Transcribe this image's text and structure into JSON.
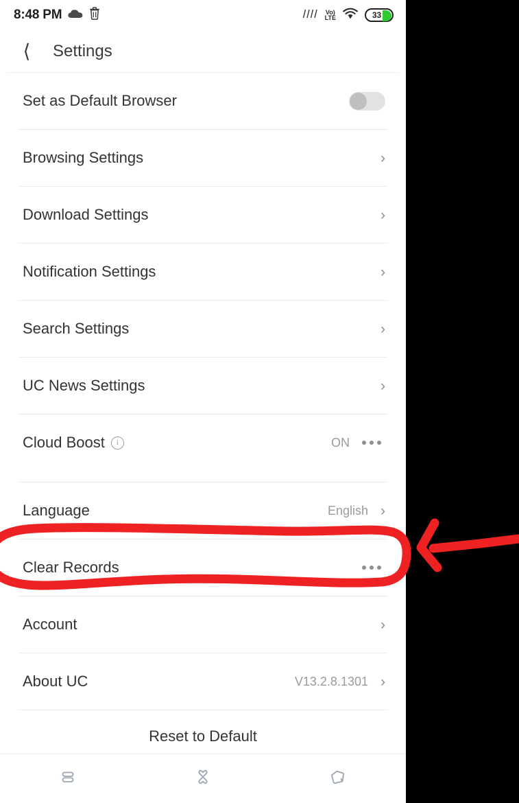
{
  "statusbar": {
    "time": "8:48 PM",
    "cloud_icon": "cloud-icon",
    "trash_icon": "trash-icon",
    "signal_icon": "signal-bars-icon",
    "network_label": "Vo)) LTE",
    "network_line1": "Vo)",
    "network_line2": "LTE",
    "wifi_icon": "wifi-icon",
    "battery_percent": "33"
  },
  "header": {
    "back_icon": "back-chevron-icon",
    "title": "Settings"
  },
  "rows": [
    {
      "label": "Set as Default Browser",
      "control": "toggle",
      "toggle_on": false
    },
    {
      "label": "Browsing Settings",
      "control": "chevron",
      "chevron": "›"
    },
    {
      "label": "Download Settings",
      "control": "chevron",
      "chevron": "›"
    },
    {
      "label": "Notification Settings",
      "control": "chevron",
      "chevron": "›"
    },
    {
      "label": "Search Settings",
      "control": "chevron",
      "chevron": "›"
    },
    {
      "label": "UC News Settings",
      "control": "chevron",
      "chevron": "›"
    },
    {
      "label": "Cloud Boost",
      "info": "i",
      "control": "dots",
      "value": "ON"
    },
    {
      "label": "Language",
      "control": "chevron",
      "chevron": "›",
      "value": "English"
    },
    {
      "label": "Clear Records",
      "control": "dots",
      "highlighted": true
    },
    {
      "label": "Account",
      "control": "chevron",
      "chevron": "›"
    },
    {
      "label": "About UC",
      "control": "chevron",
      "chevron": "›",
      "value": "V13.2.8.1301"
    }
  ],
  "reset": {
    "label": "Reset to Default"
  },
  "bottomnav": {
    "items": [
      {
        "icon": "list-lines-icon"
      },
      {
        "icon": "clover-cross-icon"
      },
      {
        "icon": "tag-slash-icon"
      }
    ]
  },
  "annotation": {
    "color": "#ee2222",
    "ellipse_target": "Clear Records",
    "arrow_direction": "left"
  },
  "colors": {
    "background": "#000000",
    "screen": "#ffffff",
    "text": "#333333",
    "muted": "#9a9a9a",
    "battery_green": "#32c832",
    "annotation_red": "#ee2222",
    "nav_icon": "#9aa5b4"
  }
}
